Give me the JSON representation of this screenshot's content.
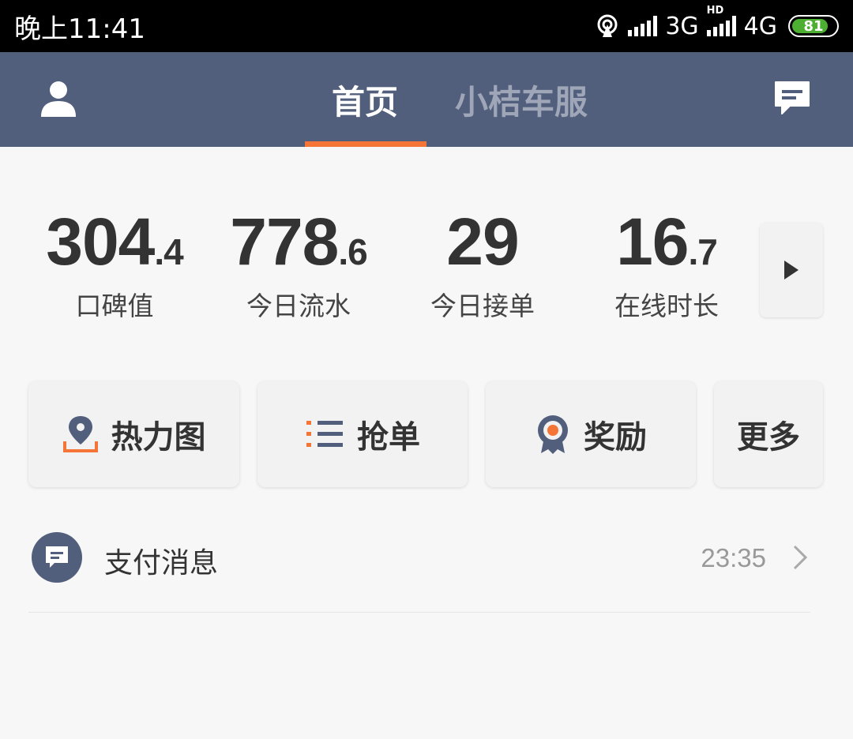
{
  "status_bar": {
    "time": "晚上11:41",
    "network1": "3G",
    "network2": "4G",
    "hd": "HD",
    "battery": "81",
    "battery_color": "#4caf32"
  },
  "header": {
    "tabs": [
      {
        "label": "首页",
        "active": true
      },
      {
        "label": "小桔车服",
        "active": false
      }
    ],
    "user_icon": "user-icon",
    "message_icon": "chat-icon",
    "accent": "#f47535",
    "bg": "#515e7c"
  },
  "stats": [
    {
      "int": "304",
      "dec": ".4",
      "label": "口碑值"
    },
    {
      "int": "778",
      "dec": ".6",
      "label": "今日流水"
    },
    {
      "int": "29",
      "dec": "",
      "label": "今日接单"
    },
    {
      "int": "16",
      "dec": ".7",
      "label": "在线时长"
    }
  ],
  "functions": [
    {
      "label": "热力图",
      "icon": "location-pin-icon"
    },
    {
      "label": "抢单",
      "icon": "list-icon"
    },
    {
      "label": "奖励",
      "icon": "medal-icon"
    },
    {
      "label": "更多",
      "icon": ""
    }
  ],
  "message": {
    "title": "支付消息",
    "time": "23:35",
    "icon": "chat-icon"
  }
}
